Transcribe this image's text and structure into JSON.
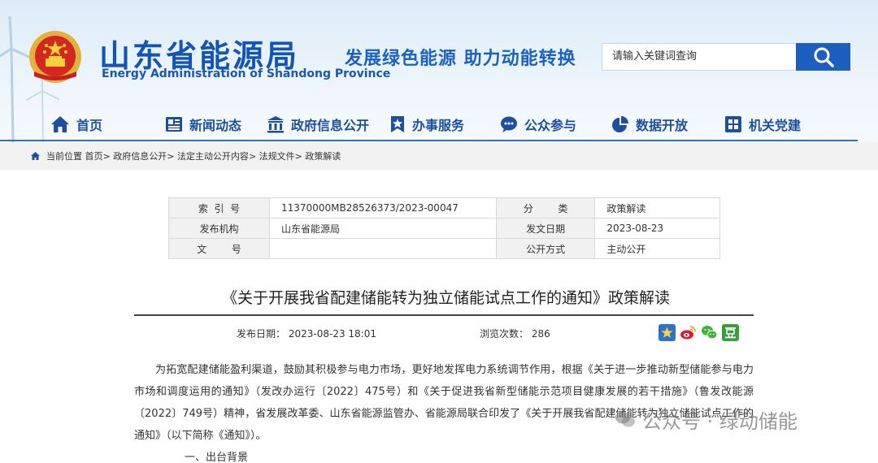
{
  "site": {
    "title": "山东省能源局",
    "title_en": "Energy Administration of Shandong Province",
    "slogan": "发展绿色能源 助力动能转换",
    "search_placeholder": "请输入关键词查询"
  },
  "nav": [
    {
      "label": "首页",
      "icon": "home-icon"
    },
    {
      "label": "新闻动态",
      "icon": "newspaper-icon"
    },
    {
      "label": "政府信息公开",
      "icon": "government-building-icon"
    },
    {
      "label": "办事服务",
      "icon": "star-bookmark-icon"
    },
    {
      "label": "公众参与",
      "icon": "chat-bubble-icon"
    },
    {
      "label": "数据开放",
      "icon": "pie-chart-icon"
    },
    {
      "label": "机关党建",
      "icon": "party-building-icon"
    }
  ],
  "breadcrumb": {
    "prefix": "当前位置",
    "items": [
      "首页",
      "政府信息公开",
      "法定主动公开内容",
      "法规文件",
      "政策解读"
    ],
    "separator": ">"
  },
  "meta": {
    "index_label": "索  引  号",
    "index_value": "11370000MB28526373/2023-00047",
    "category_label": "分        类",
    "category_value": "政策解读",
    "issuer_label": "发布机构",
    "issuer_value": "山东省能源局",
    "doc_date_label": "发文日期",
    "doc_date_value": "2023-08-23",
    "doc_no_label": "文        号",
    "doc_no_value": "",
    "publish_mode_label": "公开方式",
    "publish_mode_value": "主动公开"
  },
  "article": {
    "title": "《关于开展我省配建储能转为独立储能试点工作的通知》政策解读",
    "publish_date_label": "发布日期：",
    "publish_date": "2023-08-23 18:01",
    "views_label": "浏览次数：",
    "views": "286",
    "paragraph_1": "为拓宽配建储能盈利渠道，鼓励其积极参与电力市场，更好地发挥电力系统调节作用，根据《关于进一步推动新型储能参与电力市场和调度运用的通知》（发改办运行〔2022〕475号）和《关于促进我省新型储能示范项目健康发展的若干措施》（鲁发改能源〔2022〕749号）精神，省发展改革委、山东省能源监管办、省能源局联合印发了《关于开展我省配建储能转为独立储能试点工作的通知》（以下简称《通知》）。",
    "paragraph_2_partial": "一、出台背景"
  },
  "share_icons": [
    "qzone-star-icon",
    "weibo-icon",
    "wechat-icon",
    "douban-icon"
  ],
  "watermark": "公众号 · 绿动储能",
  "colors": {
    "brand_blue": "#1355b6",
    "nav_text": "#1d4f9e",
    "search_button": "#1c5fbf"
  }
}
